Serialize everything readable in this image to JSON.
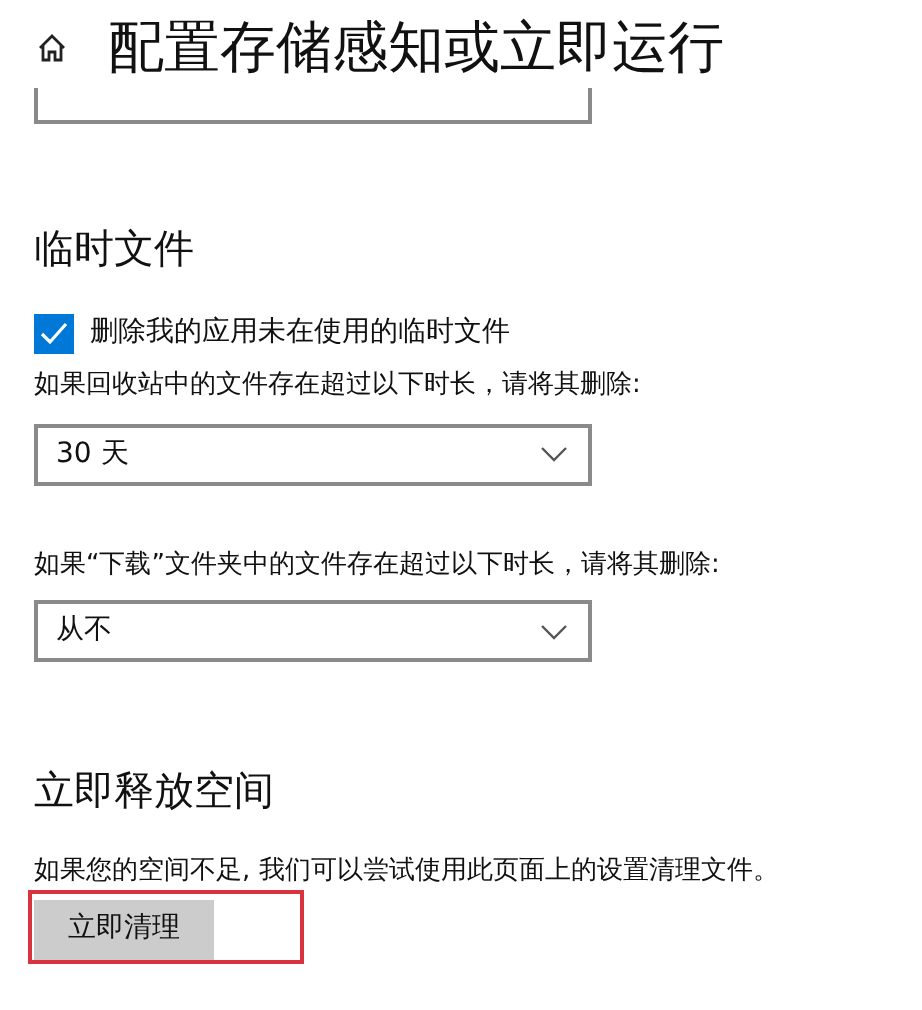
{
  "header": {
    "title": "配置存储感知或立即运行"
  },
  "temp_files": {
    "heading": "临时文件",
    "checkbox": {
      "label": "删除我的应用未在使用的临时文件",
      "checked": true
    },
    "recycle_bin": {
      "label": "如果回收站中的文件存在超过以下时长，请将其删除:",
      "value": "30 天"
    },
    "downloads": {
      "label": "如果“下载”文件夹中的文件存在超过以下时长，请将其删除:",
      "value": "从不"
    }
  },
  "free_space": {
    "heading": "立即释放空间",
    "description": "如果您的空间不足, 我们可以尝试使用此页面上的设置清理文件。",
    "button": "立即清理",
    "highlighted": true
  }
}
